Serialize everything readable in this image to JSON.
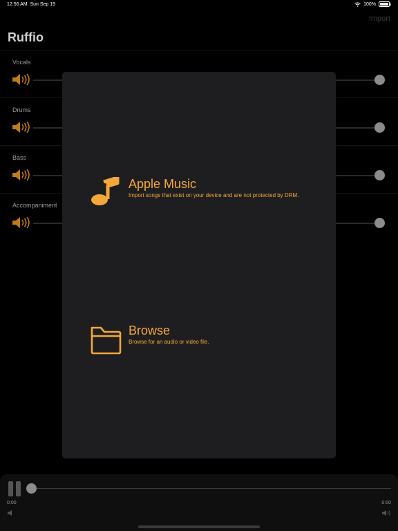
{
  "status_bar": {
    "time": "12:56 AM",
    "date": "Sun Sep 19",
    "battery": "100%",
    "icons": [
      "wifi-icon",
      "battery-icon"
    ]
  },
  "header": {
    "title": "Ruffio",
    "import_label": "Import"
  },
  "tracks": [
    {
      "label": "Vocals",
      "volume": 1.0
    },
    {
      "label": "Drums",
      "volume": 1.0
    },
    {
      "label": "Bass",
      "volume": 1.0
    },
    {
      "label": "Accompaniment",
      "volume": 1.0
    }
  ],
  "import_sheet": {
    "options": [
      {
        "title": "Apple Music",
        "subtitle": "Import songs that exist on your device and are not protected by DRM.",
        "icon": "music-note-icon"
      },
      {
        "title": "Browse",
        "subtitle": "Browse for an audio or video file.",
        "icon": "folder-icon"
      }
    ]
  },
  "player": {
    "elapsed": "0:00",
    "duration": "0:00",
    "progress": 0.0
  },
  "colors": {
    "accent": "#f4a83a",
    "speaker": "#c07a1e",
    "dialog_bg": "#1e1e20",
    "background": "#000000"
  }
}
